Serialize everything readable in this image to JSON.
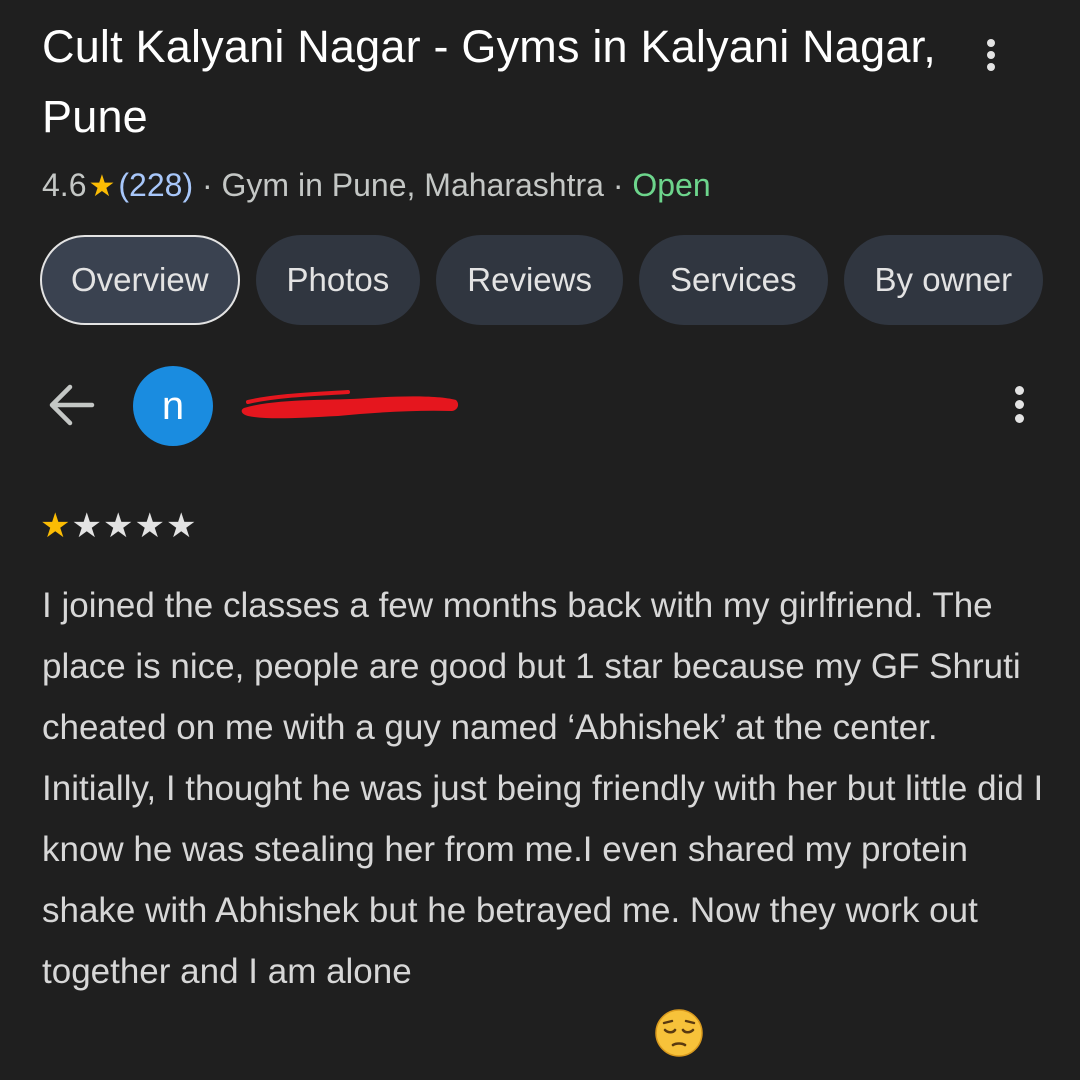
{
  "place": {
    "title": "Cult Kalyani Nagar - Gyms in Kalyani Nagar, Pune",
    "rating": "4.6",
    "review_count": "(228)",
    "category": "· Gym in Pune, Maharashtra ·",
    "status": "Open"
  },
  "tabs": [
    {
      "label": "Overview",
      "active": true
    },
    {
      "label": "Photos",
      "active": false
    },
    {
      "label": "Reviews",
      "active": false
    },
    {
      "label": "Services",
      "active": false
    },
    {
      "label": "By owner",
      "active": false
    }
  ],
  "review": {
    "avatar_letter": "n",
    "reviewer_name_redacted": true,
    "stars": 1,
    "stars_max": 5,
    "text": "I joined the classes a few months back with my girlfriend. The place is nice, people are good but 1 star because my GF Shruti cheated on me with a guy named ‘Abhishek’ at the center. Initially, I thought he was just being friendly with her but little did I know he was stealing her from me.I even shared my protein shake with Abhishek but he betrayed me. Now they work out together and I am alone"
  },
  "icons": {
    "star": "star-icon",
    "back": "back-arrow-icon",
    "more": "more-vert-icon",
    "emoji": "pensive-face-emoji-icon"
  },
  "colors": {
    "background": "#1f1f1f",
    "star": "#fbbc04",
    "link": "#a8c7fa",
    "open": "#6dd58c",
    "avatar": "#1a8ce0",
    "chip": "#303640",
    "redaction": "#e5161e"
  }
}
